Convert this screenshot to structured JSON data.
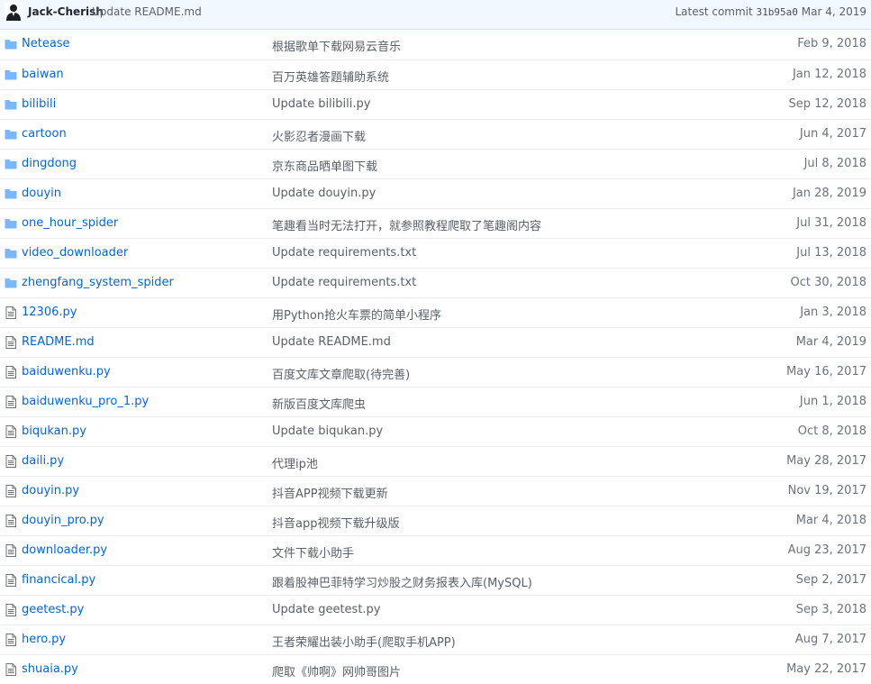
{
  "commit": {
    "author": "Jack-Cherish",
    "message": "Update README.md",
    "latest_label": "Latest commit",
    "sha": "31b95a0",
    "date": "Mar 4, 2019"
  },
  "rows": [
    {
      "type": "dir",
      "name": "Netease",
      "message": "根据歌单下载网易云音乐",
      "age": "Feb 9, 2018"
    },
    {
      "type": "dir",
      "name": "baiwan",
      "message": "百万英雄答题辅助系统",
      "age": "Jan 12, 2018"
    },
    {
      "type": "dir",
      "name": "bilibili",
      "message": "Update bilibili.py",
      "age": "Sep 12, 2018"
    },
    {
      "type": "dir",
      "name": "cartoon",
      "message": "火影忍者漫画下载",
      "age": "Jun 4, 2017"
    },
    {
      "type": "dir",
      "name": "dingdong",
      "message": "京东商品晒单图下载",
      "age": "Jul 8, 2018"
    },
    {
      "type": "dir",
      "name": "douyin",
      "message": "Update douyin.py",
      "age": "Jan 28, 2019"
    },
    {
      "type": "dir",
      "name": "one_hour_spider",
      "message": "笔趣看当时无法打开，就参照教程爬取了笔趣阁内容",
      "age": "Jul 31, 2018"
    },
    {
      "type": "dir",
      "name": "video_downloader",
      "message": "Update requirements.txt",
      "age": "Jul 13, 2018"
    },
    {
      "type": "dir",
      "name": "zhengfang_system_spider",
      "message": "Update requirements.txt",
      "age": "Oct 30, 2018"
    },
    {
      "type": "file",
      "name": "12306.py",
      "message": "用Python抢火车票的简单小程序",
      "age": "Jan 3, 2018"
    },
    {
      "type": "file",
      "name": "README.md",
      "message": "Update README.md",
      "age": "Mar 4, 2019"
    },
    {
      "type": "file",
      "name": "baiduwenku.py",
      "message": "百度文库文章爬取(待完善)",
      "age": "May 16, 2017"
    },
    {
      "type": "file",
      "name": "baiduwenku_pro_1.py",
      "message": "新版百度文库爬虫",
      "age": "Jun 1, 2018"
    },
    {
      "type": "file",
      "name": "biqukan.py",
      "message": "Update biqukan.py",
      "age": "Oct 8, 2018"
    },
    {
      "type": "file",
      "name": "daili.py",
      "message": "代理ip池",
      "age": "May 28, 2017"
    },
    {
      "type": "file",
      "name": "douyin.py",
      "message": "抖音APP视频下载更新",
      "age": "Nov 19, 2017"
    },
    {
      "type": "file",
      "name": "douyin_pro.py",
      "message": "抖音app视频下载升级版",
      "age": "Mar 4, 2018"
    },
    {
      "type": "file",
      "name": "downloader.py",
      "message": "文件下载小助手",
      "age": "Aug 23, 2017"
    },
    {
      "type": "file",
      "name": "financical.py",
      "message": "跟着股神巴菲特学习炒股之财务报表入库(MySQL)",
      "age": "Sep 2, 2017"
    },
    {
      "type": "file",
      "name": "geetest.py",
      "message": "Update geetest.py",
      "age": "Sep 3, 2018"
    },
    {
      "type": "file",
      "name": "hero.py",
      "message": "王者荣耀出装小助手(爬取手机APP)",
      "age": "Aug 7, 2017"
    },
    {
      "type": "file",
      "name": "shuaia.py",
      "message": "爬取《帅啊》网帅哥图片",
      "age": "May 22, 2017"
    }
  ],
  "colors": {
    "link": "#0366d6",
    "folder_icon": "#79b8ff",
    "file_icon": "#6a737d",
    "commit_bar_bg": "#f1f8ff"
  }
}
